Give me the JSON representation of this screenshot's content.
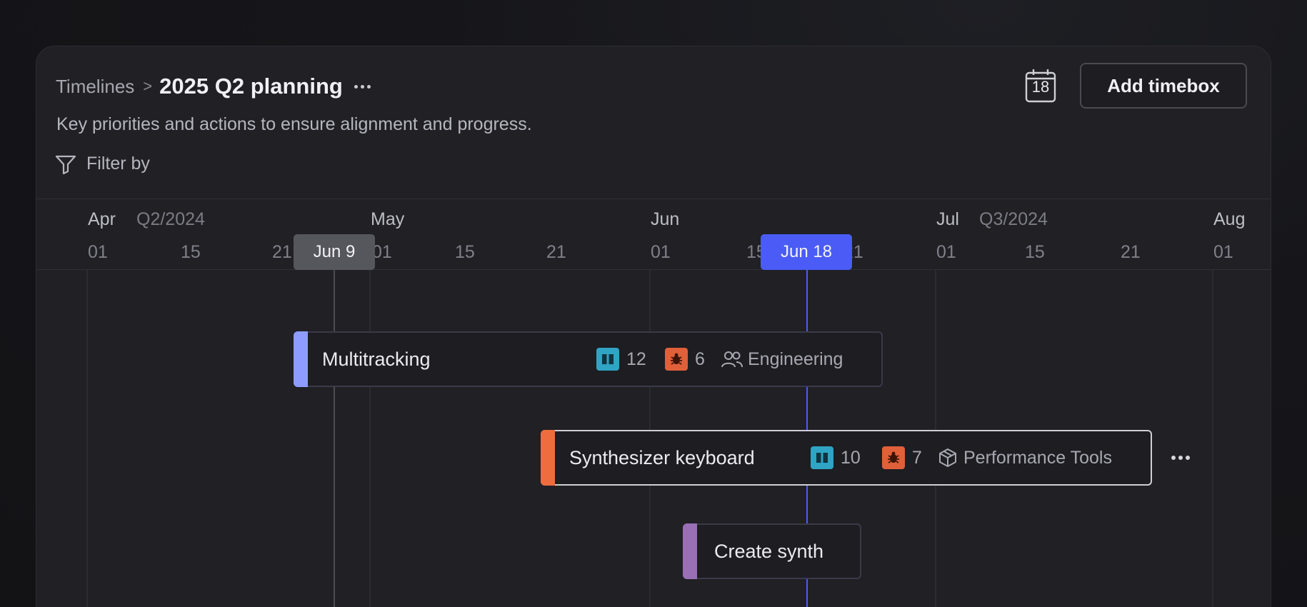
{
  "header": {
    "breadcrumb_root": "Timelines",
    "breadcrumb_separator": ">",
    "title": "2025 Q2 planning",
    "description": "Key priorities and actions to ensure alignment and progress.",
    "filter_label": "Filter by",
    "calendar_day": "18",
    "add_button": "Add timebox"
  },
  "timeline": {
    "months": [
      {
        "label": "Apr",
        "quarter": "Q2/2024"
      },
      {
        "label": "May",
        "quarter": ""
      },
      {
        "label": "Jun",
        "quarter": ""
      },
      {
        "label": "Jul",
        "quarter": "Q3/2024"
      },
      {
        "label": "Aug",
        "quarter": ""
      }
    ],
    "ticks": [
      "01",
      "15",
      "21",
      "01",
      "15",
      "21",
      "01",
      "15",
      "21",
      "01",
      "15",
      "21",
      "01"
    ],
    "markers": {
      "hover": {
        "label": "Jun 9",
        "color": "#56565d"
      },
      "today": {
        "label": "Jun 18",
        "color": "#4a5cf5"
      }
    }
  },
  "timeboxes": [
    {
      "name": "Multitracking",
      "accent": "#8e9cff",
      "stories": "12",
      "bugs": "6",
      "team_icon": "users-icon",
      "team": "Engineering"
    },
    {
      "name": "Synthesizer keyboard",
      "accent": "#ee6c3e",
      "stories": "10",
      "bugs": "7",
      "team_icon": "package-icon",
      "team": "Performance Tools"
    },
    {
      "name": "Create synth",
      "accent": "#9a6fb5"
    }
  ],
  "colors": {
    "story_badge": "#2fa4c4",
    "bug_badge": "#e0603a",
    "today_line": "#4a5cf5"
  }
}
